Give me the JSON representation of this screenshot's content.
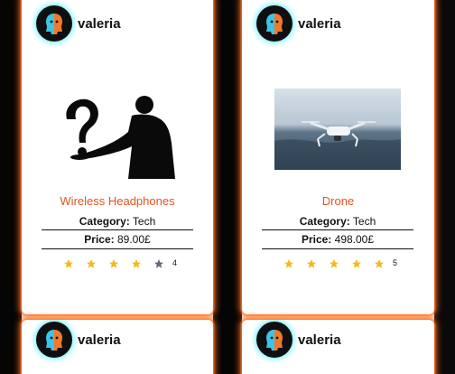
{
  "colors": {
    "accent_glow": "#ff6a1a",
    "title": "#e8531d",
    "star_filled": "#f5b91c",
    "star_empty": "#5f6b78",
    "avatar_glow": "#7cf3ff"
  },
  "cards": [
    {
      "username": "valeria",
      "avatar_icon": "face-profile-avatar-icon",
      "image_icon": "question-mark-person-silhouette",
      "title": "Wireless Headphones",
      "category_label": "Category:",
      "category": "Tech",
      "price_label": "Price:",
      "price": "89.00£",
      "rating": 4,
      "rating_count": "4"
    },
    {
      "username": "valeria",
      "avatar_icon": "face-profile-avatar-icon",
      "image_icon": "drone-photo",
      "title": "Drone",
      "category_label": "Category:",
      "category": "Tech",
      "price_label": "Price:",
      "price": "498.00£",
      "rating": 5,
      "rating_count": "5"
    },
    {
      "username": "valeria",
      "avatar_icon": "face-profile-avatar-icon"
    },
    {
      "username": "valeria",
      "avatar_icon": "face-profile-avatar-icon"
    }
  ]
}
